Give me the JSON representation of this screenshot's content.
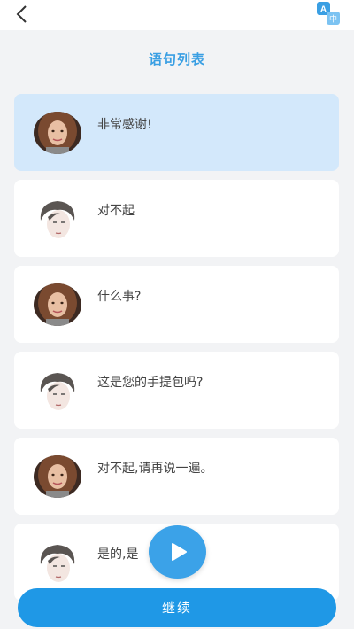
{
  "header": {
    "back_icon": "chevron-left-icon",
    "translate_icon": "translate-icon",
    "translate_glyphs": {
      "latin": "A",
      "cjk": "中"
    }
  },
  "page": {
    "title": "语句列表"
  },
  "sentences": [
    {
      "text": "非常感谢!",
      "speaker": "female",
      "active": true
    },
    {
      "text": "对不起",
      "speaker": "male",
      "active": false
    },
    {
      "text": "什么事?",
      "speaker": "female",
      "active": false
    },
    {
      "text": "这是您的手提包吗?",
      "speaker": "male",
      "active": false
    },
    {
      "text": "对不起,请再说一遍。",
      "speaker": "female",
      "active": false
    },
    {
      "text": "是的,是",
      "speaker": "male",
      "active": false
    }
  ],
  "controls": {
    "play_icon": "play-icon",
    "continue_label": "继续"
  },
  "colors": {
    "accent": "#1f98e6",
    "title": "#3a9fe3",
    "active_card": "#d3e8fb",
    "background": "#f2f3f5"
  }
}
